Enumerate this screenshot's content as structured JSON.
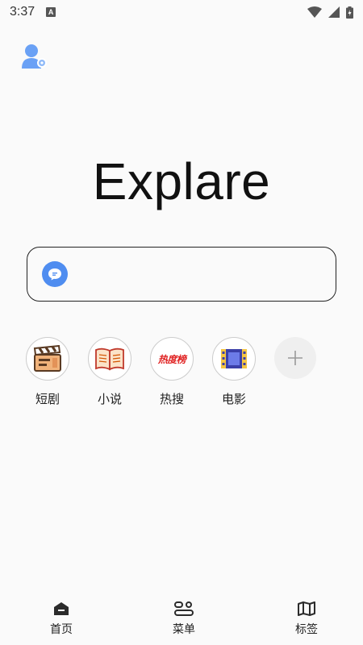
{
  "status_bar": {
    "time": "3:37",
    "indicator": "A"
  },
  "header": {
    "brand": "Explare"
  },
  "search": {
    "placeholder": ""
  },
  "shortcuts": [
    {
      "label": "短剧",
      "icon": "clapperboard-icon"
    },
    {
      "label": "小说",
      "icon": "open-book-icon"
    },
    {
      "label": "热搜",
      "icon": "hot-list-icon",
      "badge_text": "热度榜"
    },
    {
      "label": "电影",
      "icon": "film-icon"
    }
  ],
  "add_shortcut": {
    "icon": "plus-icon"
  },
  "bottom_nav": [
    {
      "label": "首页",
      "icon": "home-icon"
    },
    {
      "label": "菜单",
      "icon": "menu-icon"
    },
    {
      "label": "标签",
      "icon": "map-icon"
    }
  ],
  "colors": {
    "accent_blue": "#4f8df0",
    "border": "#222222",
    "background": "#fafafa",
    "hot_red": "#e02020"
  }
}
